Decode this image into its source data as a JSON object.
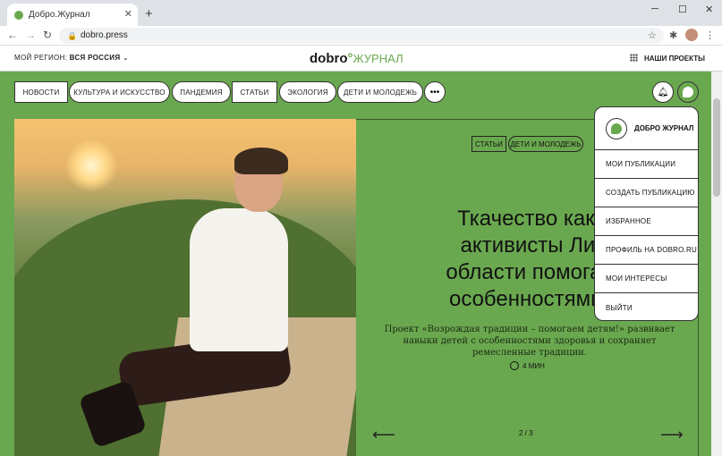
{
  "browser": {
    "tab_title": "Добро.Журнал",
    "tab_close": "✕",
    "new_tab": "+",
    "url": "dobro.press",
    "nav_back": "←",
    "nav_forward": "→",
    "nav_reload": "↻",
    "window_min": "─",
    "window_max": "☐",
    "window_close": "✕"
  },
  "site": {
    "region_label": "МОЙ РЕГИОН:",
    "region_value": "ВСЯ РОССИЯ",
    "logo_main": "dobro",
    "logo_sub": "ЖУРНАЛ",
    "projects": "НАШИ ПРОЕКТЫ"
  },
  "categories": [
    {
      "label": "НОВОСТИ"
    },
    {
      "label": "КУЛЬТУРА И ИСКУССТВО"
    },
    {
      "label": "ПАНДЕМИЯ"
    },
    {
      "label": "СТАТЬИ"
    },
    {
      "label": "ЭКОЛОГИЯ"
    },
    {
      "label": "ДЕТИ И МОЛОДЕЖЬ"
    }
  ],
  "more_button": "•••",
  "article": {
    "tags": [
      "СТАТЬИ",
      "ДЕТИ И МОЛОДЕЖЬ"
    ],
    "headline_lines": [
      "Ткачество как тер",
      "активисты Липец",
      "области помогают д",
      "особенностями здо"
    ],
    "lead": "Проект «Возрождая традиции – помогаем детям!» развивает навыки детей с особенностями здоровья и сохраняет ремесленные традиции.",
    "read_time": "4 МИН",
    "pager": "2 / 3",
    "prev_arrow": "⟵",
    "next_arrow": "⟶"
  },
  "profile_menu": {
    "name": "ДОБРО ЖУРНАЛ",
    "items": [
      {
        "label": "МОИ ПУБЛИКАЦИИ"
      },
      {
        "label": "СОЗДАТЬ ПУБЛИКАЦИЮ"
      },
      {
        "label": "ИЗБРАННОЕ"
      },
      {
        "label": "ПРОФИЛЬ НА DOBRO.RU"
      },
      {
        "label": "МОИ ИНТЕРЕСЫ"
      },
      {
        "label": "ВЫЙТИ"
      }
    ]
  },
  "icons": {
    "bell": "bell-icon",
    "profile": "profile-icon",
    "clock": "clock-icon",
    "chevron": "chevron-down-icon"
  },
  "colors": {
    "accent_green": "#6aa84f"
  }
}
